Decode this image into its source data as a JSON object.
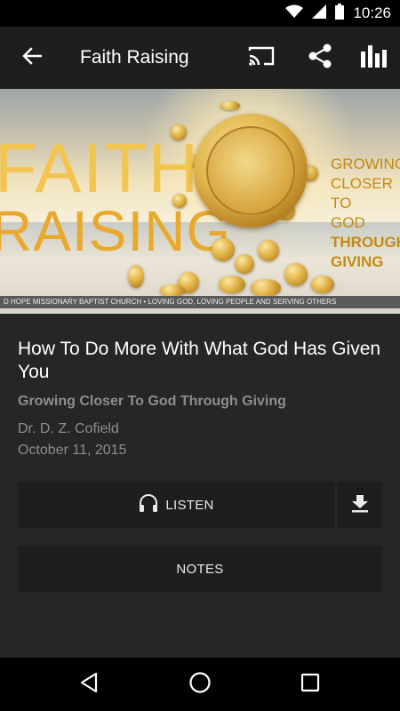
{
  "status_bar": {
    "time": "10:26",
    "icons": [
      "wifi-icon",
      "signal-icon",
      "battery-icon"
    ]
  },
  "app_bar": {
    "title": "Faith Raising",
    "actions": [
      "back-arrow-icon",
      "cast-icon",
      "share-icon",
      "bar-chart-icon"
    ]
  },
  "banner": {
    "word1": "FAITH",
    "word2": "RAISING",
    "tagline_line1": "GROWING",
    "tagline_line2": "CLOSER TO",
    "tagline_line3": "GOD",
    "tagline_line4": "THROUGH",
    "tagline_line5": "GIVING",
    "footer": "D HOPE MISSIONARY BAPTIST CHURCH • LOVING GOD, LOVING PEOPLE AND SERVING OTHERS"
  },
  "sermon": {
    "title": "How To Do More With What God Has Given You",
    "series": "Growing Closer To God Through Giving",
    "speaker": "Dr. D. Z. Cofield",
    "date": "October 11, 2015"
  },
  "actions": {
    "listen_label": "LISTEN",
    "notes_label": "NOTES"
  },
  "colors": {
    "background": "#262626",
    "app_bar": "#1e1e1e",
    "button": "#1e1e1e",
    "secondary_text": "#8d8d8d",
    "banner_gold": "#e9a92d"
  },
  "nav_bar": {
    "buttons": [
      "back-triangle-icon",
      "home-circle-icon",
      "recents-square-icon"
    ]
  }
}
